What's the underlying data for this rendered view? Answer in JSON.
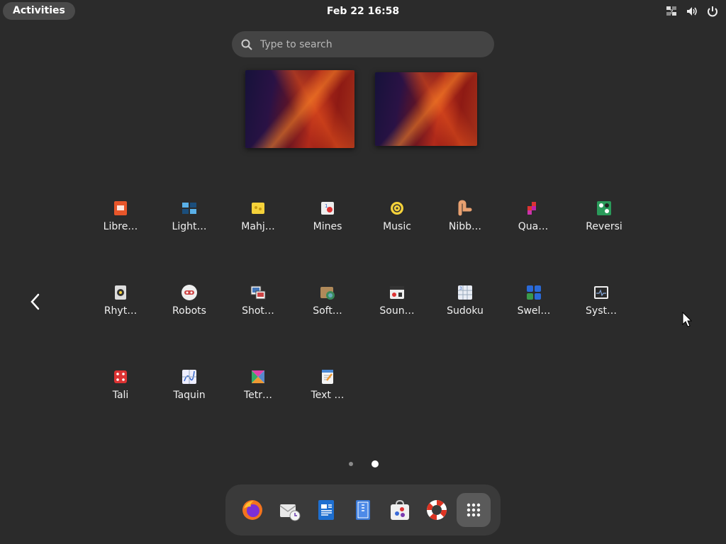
{
  "topbar": {
    "activities_label": "Activities",
    "clock": "Feb 22  16:58",
    "tray_icons": [
      "network-icon",
      "volume-icon",
      "power-icon"
    ]
  },
  "search": {
    "placeholder": "Type to search"
  },
  "workspaces": [
    "workspace-1",
    "workspace-2"
  ],
  "apps": [
    {
      "label": "Libre…",
      "icon": "libreoffice-impress-icon"
    },
    {
      "label": "Light…",
      "icon": "lightsoff-icon"
    },
    {
      "label": "Mahj…",
      "icon": "mahjongg-icon"
    },
    {
      "label": "Mines",
      "icon": "mines-icon"
    },
    {
      "label": "Music",
      "icon": "music-icon"
    },
    {
      "label": "Nibb…",
      "icon": "nibbles-icon"
    },
    {
      "label": "Qua…",
      "icon": "quadrapassel-icon"
    },
    {
      "label": "Reversi",
      "icon": "reversi-icon"
    },
    {
      "label": "Rhyt…",
      "icon": "rhythmbox-icon"
    },
    {
      "label": "Robots",
      "icon": "robots-icon"
    },
    {
      "label": "Shot…",
      "icon": "shotwell-icon"
    },
    {
      "label": "Soft…",
      "icon": "software-properties-icon"
    },
    {
      "label": "Soun…",
      "icon": "sound-recorder-icon"
    },
    {
      "label": "Sudoku",
      "icon": "sudoku-icon"
    },
    {
      "label": "Swel…",
      "icon": "swell-foop-icon"
    },
    {
      "label": "Syst…",
      "icon": "system-monitor-icon"
    },
    {
      "label": "Tali",
      "icon": "tali-icon"
    },
    {
      "label": "Taquin",
      "icon": "taquin-icon"
    },
    {
      "label": "Tetr…",
      "icon": "tetravex-icon"
    },
    {
      "label": "Text …",
      "icon": "text-editor-icon"
    }
  ],
  "pagination": {
    "current_page": 2,
    "total_pages": 2
  },
  "dock": [
    {
      "name": "firefox",
      "icon": "firefox-icon"
    },
    {
      "name": "evolution",
      "icon": "mail-clock-icon"
    },
    {
      "name": "libreoffice-writer",
      "icon": "writer-icon"
    },
    {
      "name": "files",
      "icon": "files-icon"
    },
    {
      "name": "software",
      "icon": "software-store-icon"
    },
    {
      "name": "help",
      "icon": "help-lifebuoy-icon"
    },
    {
      "name": "show-apps",
      "icon": "app-grid-icon"
    }
  ],
  "colors": {
    "background": "#2b2b2b",
    "accent": "#ffffff",
    "dock": "#3a3a3a"
  }
}
